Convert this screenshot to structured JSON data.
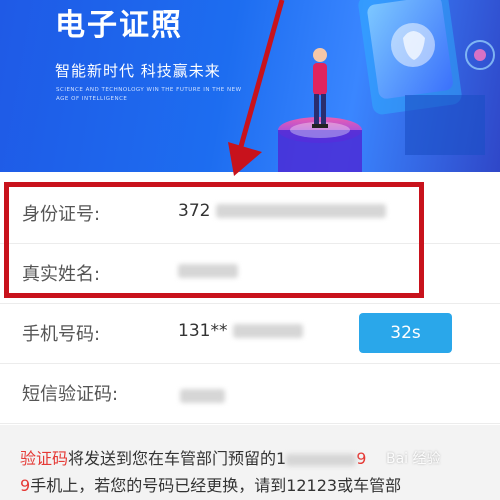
{
  "banner": {
    "title": "电子证照",
    "slogan": "智能新时代  科技赢未来",
    "subtitle_en": "SCIENCE AND TECHNOLOGY WIN THE FUTURE IN THE NEW AGE OF INTELLIGENCE"
  },
  "form": {
    "id_number": {
      "label": "身份证号:",
      "value_visible": "372"
    },
    "real_name": {
      "label": "真实姓名:"
    },
    "phone": {
      "label": "手机号码:",
      "value_visible": "131**"
    },
    "sms_code": {
      "label": "短信验证码:"
    },
    "code_button": {
      "label": "32s"
    }
  },
  "notice": {
    "highlight": "验证码",
    "line1_rest": "将发送到您在车管部门预留的1",
    "line1_tail": "9",
    "line2": "9手机上，若您的号码已经更换，请到12123或车管部"
  },
  "watermark": {
    "text": "Bai 经验"
  },
  "colors": {
    "accent_blue": "#2aa7ea",
    "highlight_red": "#c8121c",
    "notice_red": "#e53935"
  }
}
